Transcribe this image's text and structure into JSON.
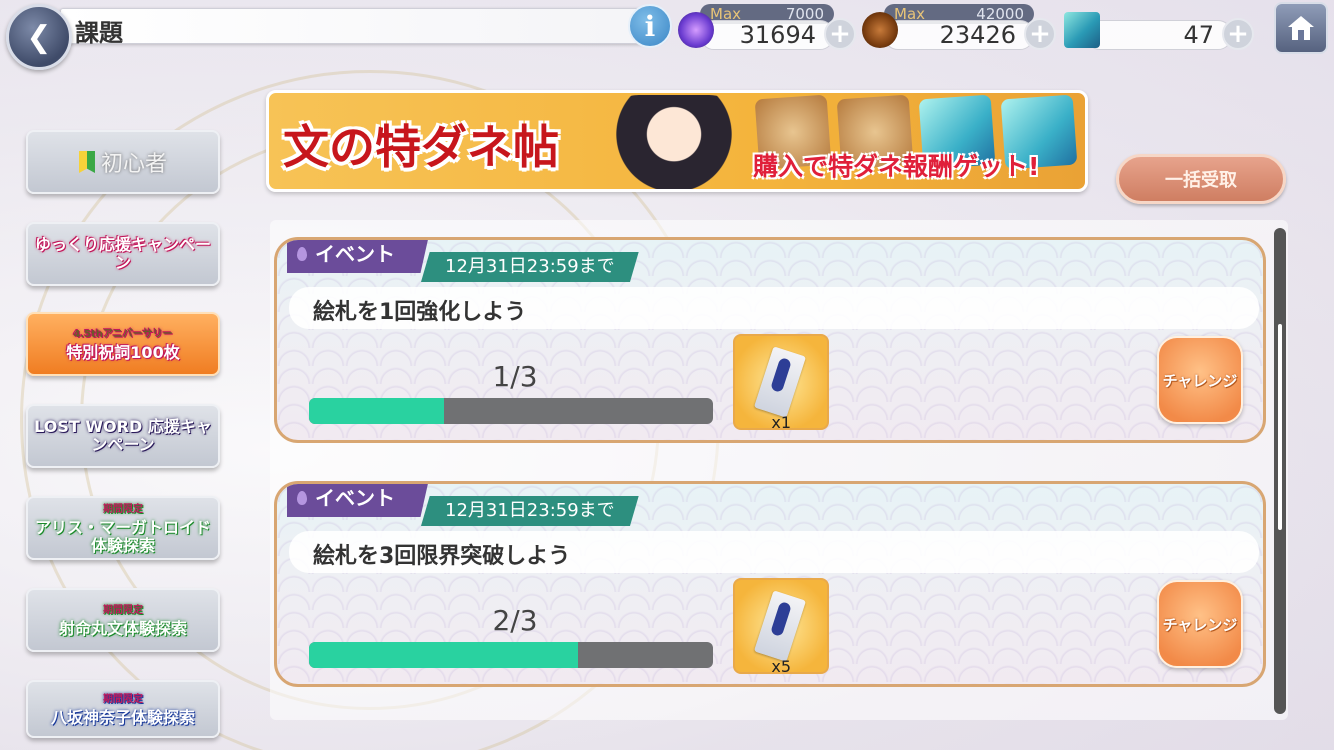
{
  "header": {
    "title": "課題",
    "info_label": "i",
    "resources": [
      {
        "name": "spirit",
        "max_label": "Max",
        "max_value": "7000",
        "value": "31694",
        "icon": "blue-flame-icon"
      },
      {
        "name": "coin",
        "max_label": "Max",
        "max_value": "42000",
        "value": "23426",
        "icon": "gourd-icon"
      },
      {
        "name": "cube",
        "max_label": "",
        "max_value": "",
        "value": "47",
        "icon": "blue-cube-icon"
      }
    ],
    "plus_label": "+"
  },
  "sidebar": {
    "items": [
      {
        "label": "初心者",
        "sub": ""
      },
      {
        "label": "ゆっくり応援キャンペーン",
        "sub": ""
      },
      {
        "label": "特別祝詞100枚",
        "sub": "4.5thアニバーサリー"
      },
      {
        "label": "LOST WORD 応援キャンペーン",
        "sub": ""
      },
      {
        "label": "アリス・マーガトロイド体験探索",
        "sub": "期間限定"
      },
      {
        "label": "射命丸文体験探索",
        "sub": "期間限定"
      },
      {
        "label": "八坂神奈子体験探索",
        "sub": "期間限定"
      }
    ]
  },
  "banner": {
    "title": "文の特ダネ帖",
    "subtitle": "購入で特ダネ報酬ゲット!"
  },
  "bulk_receive_label": "一括受取",
  "tasks": [
    {
      "tag": "イベント",
      "deadline": "12月31日23:59まで",
      "description": "絵札を1回強化しよう",
      "progress_text": "1/3",
      "progress_fraction": 0.333,
      "reward_qty": "x1",
      "action_label": "チャレンジ"
    },
    {
      "tag": "イベント",
      "deadline": "12月31日23:59まで",
      "description": "絵札を3回限界突破しよう",
      "progress_text": "2/3",
      "progress_fraction": 0.667,
      "reward_qty": "x5",
      "action_label": "チャレンジ"
    }
  ],
  "colors": {
    "tag_purple": "#6b4c9a",
    "deadline_teal": "#2d8f7f",
    "progress_green": "#29d2a0",
    "card_border": "#d8a672"
  }
}
